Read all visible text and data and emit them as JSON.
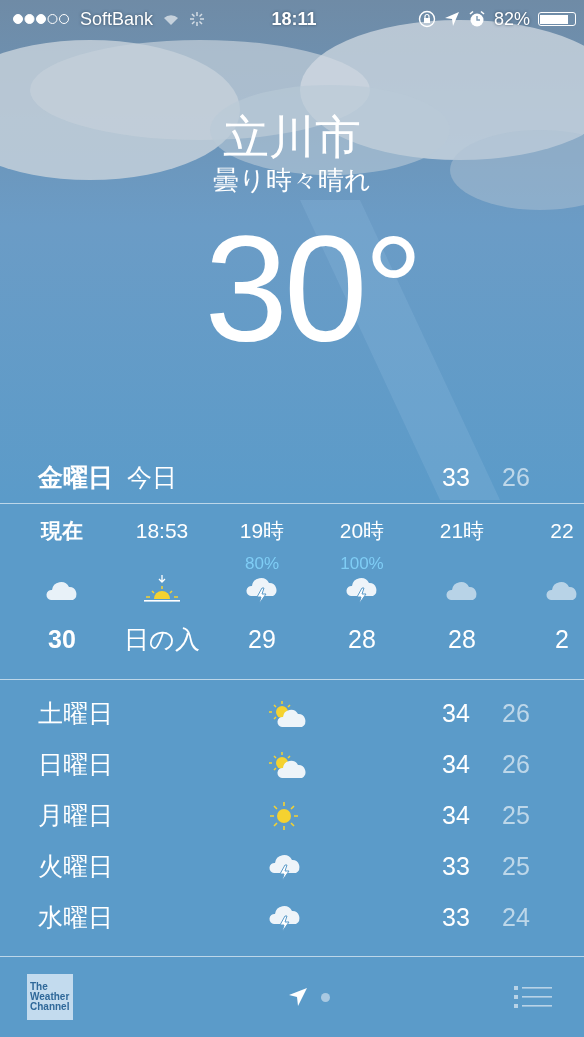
{
  "status_bar": {
    "carrier": "SoftBank",
    "time": "18:11",
    "battery": "82%"
  },
  "location": {
    "city": "立川市",
    "condition": "曇り時々晴れ",
    "temperature": "30°"
  },
  "today": {
    "day": "金曜日",
    "label": "今日",
    "high": "33",
    "low": "26"
  },
  "hourly": [
    {
      "time": "現在",
      "kind": "cloud",
      "temp": "30",
      "now": true
    },
    {
      "time": "18:53",
      "kind": "sunset",
      "temp": "日の入",
      "now": false
    },
    {
      "time": "19時",
      "precip": "80%",
      "kind": "thunder",
      "temp": "29",
      "now": false
    },
    {
      "time": "20時",
      "precip": "100%",
      "kind": "thunder",
      "temp": "28",
      "now": false
    },
    {
      "time": "21時",
      "kind": "cloud_dim",
      "temp": "28",
      "now": false
    },
    {
      "time": "22",
      "kind": "cloud_dim",
      "temp": "2",
      "now": false
    }
  ],
  "daily": [
    {
      "day": "土曜日",
      "kind": "partly_sunny",
      "high": "34",
      "low": "26"
    },
    {
      "day": "日曜日",
      "kind": "partly_sunny",
      "high": "34",
      "low": "26"
    },
    {
      "day": "月曜日",
      "kind": "sunny",
      "high": "34",
      "low": "25"
    },
    {
      "day": "火曜日",
      "kind": "thunder",
      "high": "33",
      "low": "25"
    },
    {
      "day": "水曜日",
      "kind": "thunder",
      "high": "33",
      "low": "24"
    }
  ],
  "footer": {
    "logo": [
      "The",
      "Weather",
      "Channel"
    ],
    "pages": [
      {
        "kind": "location",
        "selected": true
      },
      {
        "kind": "dot",
        "selected": false
      }
    ]
  }
}
